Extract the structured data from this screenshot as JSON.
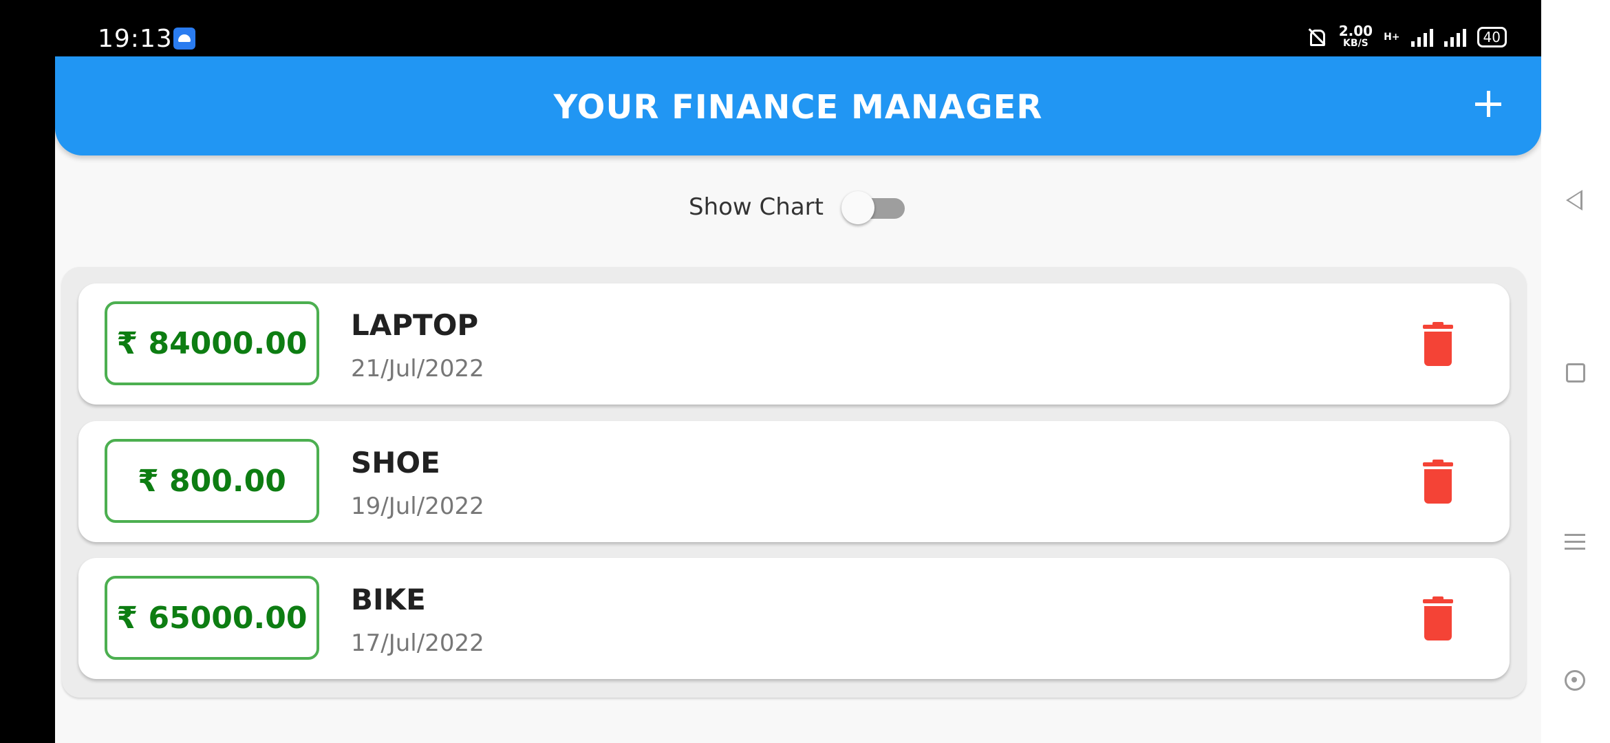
{
  "status_bar": {
    "time": "19:13",
    "net_speed_value": "2.00",
    "net_speed_unit": "KB/S",
    "network_type": "H+",
    "battery": "40"
  },
  "appbar": {
    "title": "YOUR FINANCE MANAGER",
    "add_icon": "plus-icon"
  },
  "chart_toggle": {
    "label": "Show Chart",
    "enabled": false
  },
  "transactions": [
    {
      "amount": "₹ 84000.00",
      "title": "LAPTOP",
      "date": "21/Jul/2022"
    },
    {
      "amount": "₹ 800.00",
      "title": "SHOE",
      "date": "19/Jul/2022"
    },
    {
      "amount": "₹ 65000.00",
      "title": "BIKE",
      "date": "17/Jul/2022"
    }
  ],
  "colors": {
    "primary": "#2196f3",
    "amount_border": "#4caf50",
    "amount_text": "#0d7d12",
    "delete": "#f44336"
  }
}
